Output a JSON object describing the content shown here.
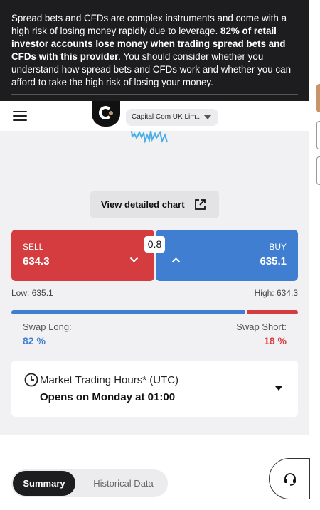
{
  "risk_warning": {
    "part1": "Spread bets and CFDs are complex instruments and come with a high risk of losing money rapidly due to leverage. ",
    "bold": "82% of retail investor accounts lose money when trading spread bets and CFDs with this provider",
    "part2": ". You should consider whether you understand how spread bets and CFDs work and whether you can afford to take the high risk of losing your money."
  },
  "header": {
    "entity_label": "Capital Com UK Lim..."
  },
  "chart": {
    "view_button_label": "View detailed chart"
  },
  "trade": {
    "sell_label": "SELL",
    "sell_price": "634.3",
    "buy_label": "BUY",
    "buy_price": "635.1",
    "spread": "0.8",
    "low_text": "Low: 635.1",
    "high_text": "High: 634.3"
  },
  "sentiment": {
    "long_percent": 82,
    "short_percent": 18,
    "swap_long_label": "Swap Long:",
    "swap_long_value": "82 %",
    "swap_short_label": "Swap Short:",
    "swap_short_value": "18 %"
  },
  "market_hours": {
    "title": "Market Trading Hours* (UTC)",
    "status": "Opens on Monday at 01:00"
  },
  "tabs": {
    "summary": "Summary",
    "historical": "Historical Data"
  },
  "colors": {
    "sell": "#d53c3f",
    "buy": "#3f7ed1",
    "banner": "#1d1d1f",
    "accent": "#c8956a"
  },
  "icons": {
    "menu": "menu-icon",
    "expand": "expand-icon",
    "clock": "clock-icon",
    "support": "headset-icon"
  }
}
